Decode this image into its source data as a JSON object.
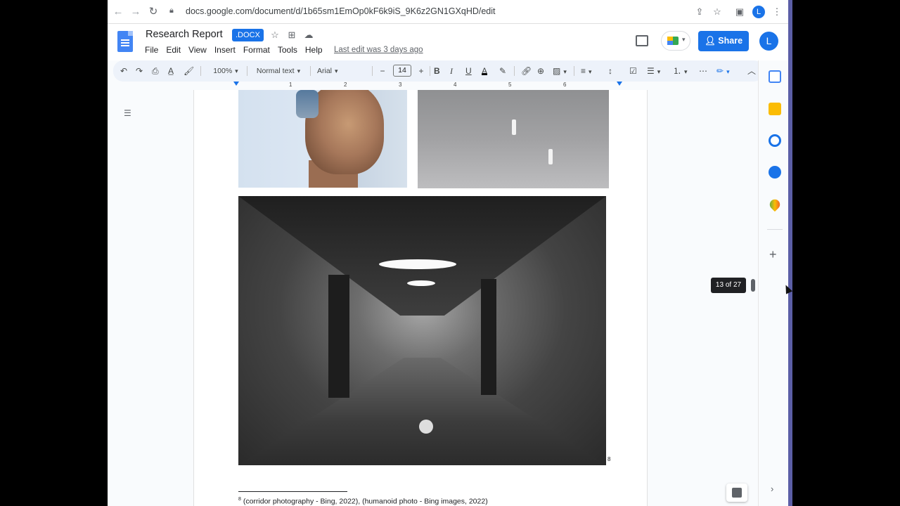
{
  "browser": {
    "url": "docs.google.com/document/d/1b65sm1EmOp0kF6k9iS_9K6z2GN1GXqHD/edit",
    "profile_initial": "L"
  },
  "docs": {
    "title": "Research Report",
    "badge": ".DOCX",
    "menu": [
      "File",
      "Edit",
      "View",
      "Insert",
      "Format",
      "Tools",
      "Help"
    ],
    "last_edit": "Last edit was 3 days ago",
    "share_label": "Share",
    "account_initial": "L"
  },
  "toolbar": {
    "zoom": "100%",
    "style": "Normal text",
    "font": "Arial",
    "font_size": "14",
    "minus": "−",
    "plus": "+"
  },
  "ruler": {
    "numbers": [
      "1",
      "2",
      "3",
      "4",
      "5",
      "6"
    ]
  },
  "document": {
    "footnote_marker": "8",
    "footnote_number": "8",
    "footnote_text": "(corridor photography - Bing, 2022), (humanoid photo - Bing images, 2022)"
  },
  "page_indicator": "13 of 27",
  "colors": {
    "accent": "#1a73e8",
    "toolbar_bg": "#edf2fa",
    "page_bg": "#f9fbfd"
  },
  "icons": {
    "side_panel": [
      "calendar-icon",
      "keep-icon",
      "tasks-icon",
      "contacts-icon",
      "maps-icon"
    ]
  }
}
